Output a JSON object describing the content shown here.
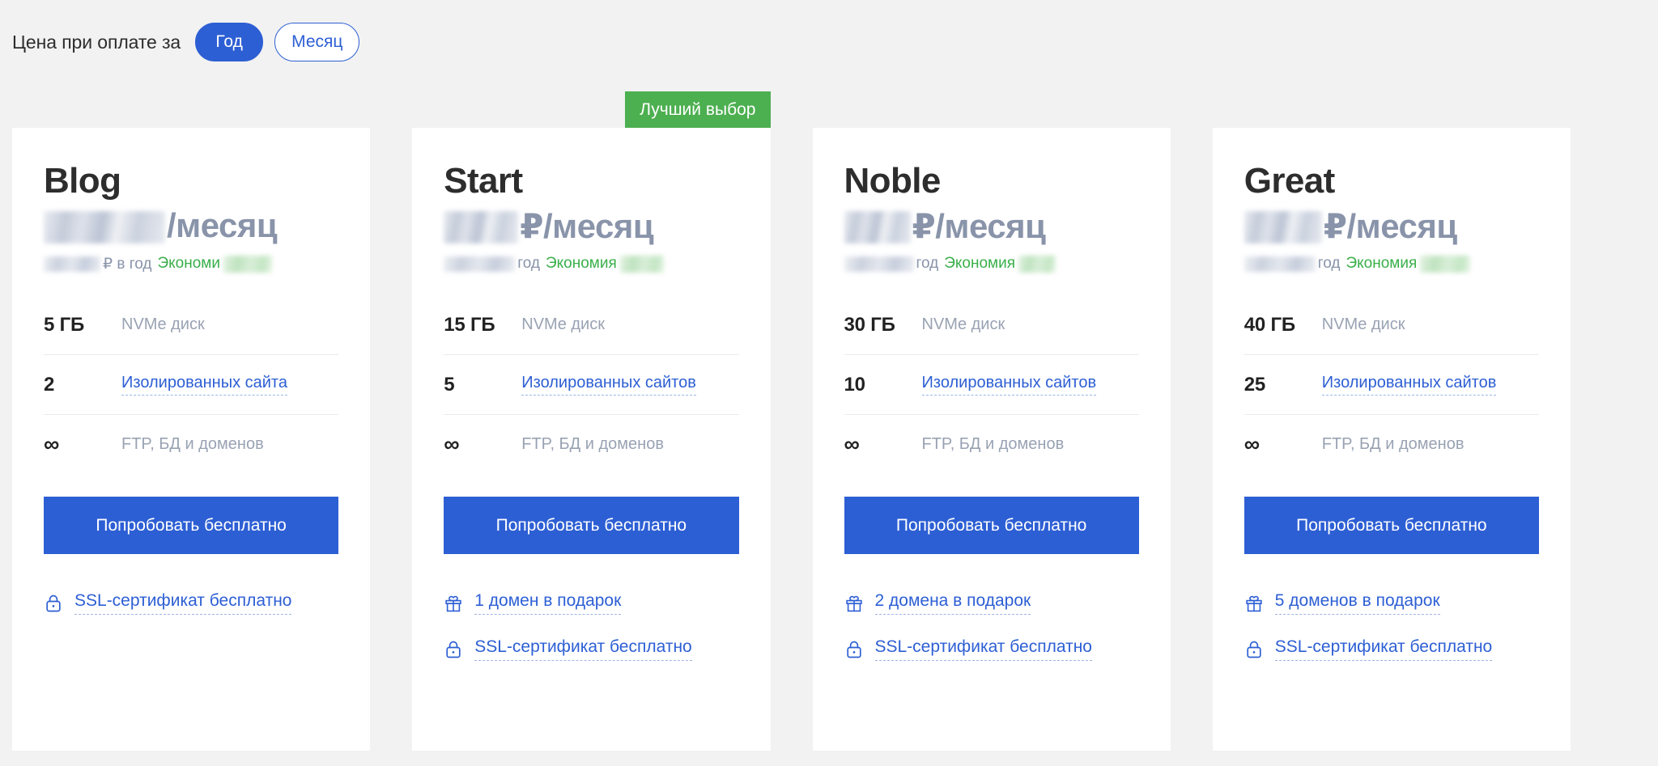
{
  "billing": {
    "label": "Цена при оплате за",
    "options": [
      {
        "label": "Год",
        "selected": true
      },
      {
        "label": "Месяц",
        "selected": false
      }
    ],
    "accent_color": "#2d5fd4"
  },
  "badge": {
    "label": "Лучший выбор",
    "color": "#4caf50"
  },
  "common": {
    "price_unit": "₽/месяц",
    "price_unit_blog": "/месяц",
    "year_suffix": "₽ в год",
    "year_suffix_short": "год",
    "savings_label_full": "Экономия",
    "savings_label_cut": "Экономи",
    "disk_label": "NVMe диск",
    "ftp_label": "FTP, БД и доменов",
    "infinity": "∞",
    "cta_label": "Попробовать бесплатно",
    "ssl_label": "SSL-сертификат бесплатно",
    "link_color": "#2d5fd4",
    "muted_color": "#99a2b3",
    "savings_color": "#39af4a",
    "card_bg": "#ffffff",
    "page_bg": "#f2f2f2"
  },
  "plans": [
    {
      "name": "Blog",
      "price_unit": "/месяц",
      "price_blur_width": 150,
      "year_blur_width": 70,
      "year_suffix": "₽ в год",
      "savings_label": "Экономи",
      "savings_blur_width": 60,
      "specs": [
        {
          "qty": "5 ГБ",
          "text": "NVMe диск",
          "link": false
        },
        {
          "qty": "2",
          "text": "Изолированных сайта",
          "link": true
        },
        {
          "qty": "∞",
          "text": "FTP, БД и доменов",
          "link": false
        }
      ],
      "cta": "Попробовать бесплатно",
      "bonuses": [
        {
          "icon": "lock-icon",
          "text": "SSL-сертификат бесплатно"
        }
      ]
    },
    {
      "name": "Start",
      "price_unit": "₽/месяц",
      "price_blur_width": 92,
      "year_blur_width": 88,
      "year_suffix": "год",
      "savings_label": "Экономия",
      "savings_blur_width": 54,
      "badge": "Лучший выбор",
      "specs": [
        {
          "qty": "15 ГБ",
          "text": "NVMe диск",
          "link": false
        },
        {
          "qty": "5",
          "text": "Изолированных сайтов",
          "link": true
        },
        {
          "qty": "∞",
          "text": "FTP, БД и доменов",
          "link": false
        }
      ],
      "cta": "Попробовать бесплатно",
      "bonuses": [
        {
          "icon": "gift-icon",
          "text": "1 домен в подарок"
        },
        {
          "icon": "lock-icon",
          "text": "SSL-сертификат бесплатно"
        }
      ]
    },
    {
      "name": "Noble",
      "price_unit": "₽/месяц",
      "price_blur_width": 82,
      "year_blur_width": 86,
      "year_suffix": "год",
      "savings_label": "Экономия",
      "savings_blur_width": 46,
      "specs": [
        {
          "qty": "30 ГБ",
          "text": "NVMe диск",
          "link": false
        },
        {
          "qty": "10",
          "text": "Изолированных сайтов",
          "link": true
        },
        {
          "qty": "∞",
          "text": "FTP, БД и доменов",
          "link": false
        }
      ],
      "cta": "Попробовать бесплатно",
      "bonuses": [
        {
          "icon": "gift-icon",
          "text": "2 домена в подарок"
        },
        {
          "icon": "lock-icon",
          "text": "SSL-сертификат бесплатно"
        }
      ]
    },
    {
      "name": "Great",
      "price_unit": "₽/месяц",
      "price_blur_width": 96,
      "year_blur_width": 88,
      "year_suffix": "год",
      "savings_label": "Экономия",
      "savings_blur_width": 62,
      "specs": [
        {
          "qty": "40 ГБ",
          "text": "NVMe диск",
          "link": false
        },
        {
          "qty": "25",
          "text": "Изолированных сайтов",
          "link": true
        },
        {
          "qty": "∞",
          "text": "FTP, БД и доменов",
          "link": false
        }
      ],
      "cta": "Попробовать бесплатно",
      "bonuses": [
        {
          "icon": "gift-icon",
          "text": "5 доменов в подарок"
        },
        {
          "icon": "lock-icon",
          "text": "SSL-сертификат бесплатно"
        }
      ]
    }
  ]
}
